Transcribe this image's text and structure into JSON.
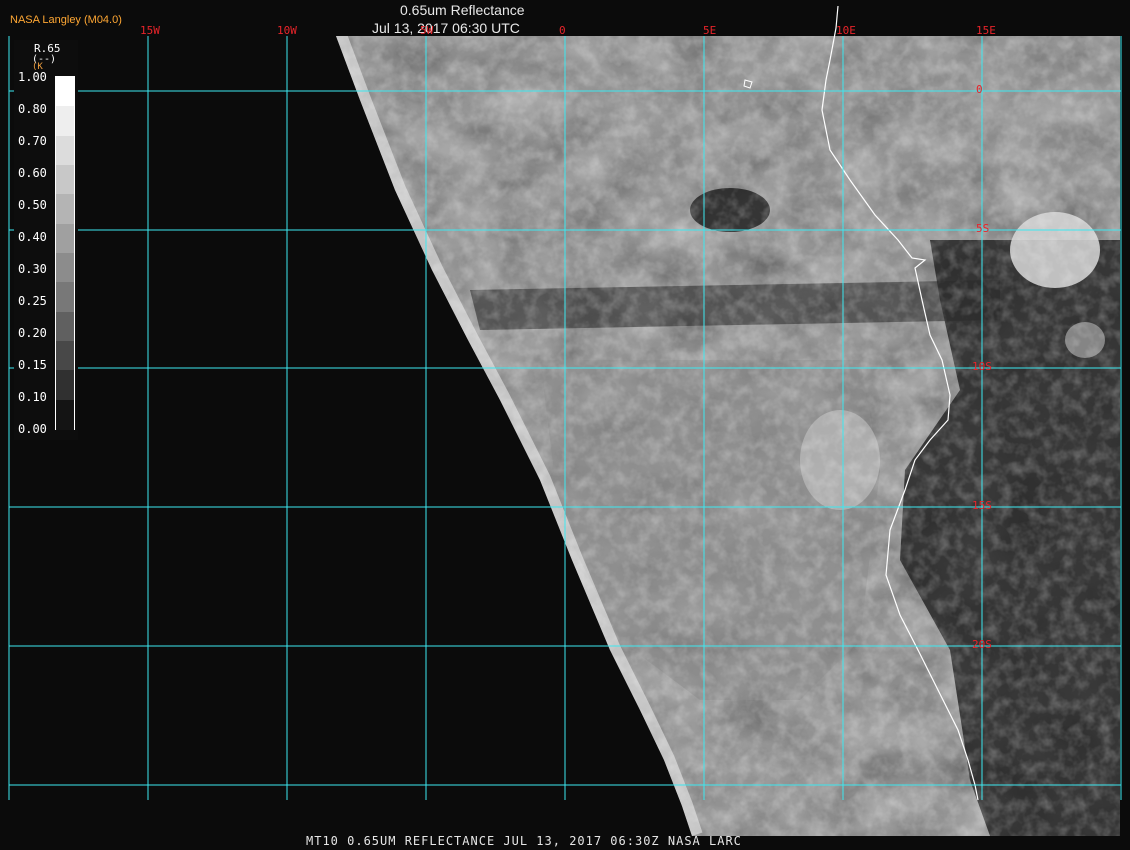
{
  "header": {
    "producer": "NASA Langley (M04.0)",
    "title": "0.65um Reflectance",
    "subtitle": "Jul 13, 2017 06:30 UTC"
  },
  "footer": {
    "text": "MT10  0.65UM REFLECTANCE   JUL 13, 2017 06:30Z   NASA LARC"
  },
  "longitude_labels": [
    "15W",
    "10W",
    "5W",
    "0",
    "5E",
    "10E",
    "15E"
  ],
  "latitude_labels": [
    "0",
    "5S",
    "10S",
    "15S",
    "20S"
  ],
  "legend": {
    "title": "R.65",
    "unit": "(--)",
    "unit_mark": "(K",
    "ticks": [
      "1.00",
      "0.80",
      "0.70",
      "0.60",
      "0.50",
      "0.40",
      "0.30",
      "0.25",
      "0.20",
      "0.15",
      "0.10",
      "0.00"
    ],
    "colors": [
      "#ffffff",
      "#eeeeee",
      "#dcdcdc",
      "#c8c8c8",
      "#b4b4b4",
      "#a0a0a0",
      "#8c8c8c",
      "#787878",
      "#606060",
      "#484848",
      "#303030",
      "#141414"
    ]
  },
  "colors": {
    "grid": "#3ce8f0",
    "coastline": "#ffffff",
    "label_red": "#e8242a",
    "producer_orange": "#ffa733",
    "space": "#0b0b0b"
  }
}
